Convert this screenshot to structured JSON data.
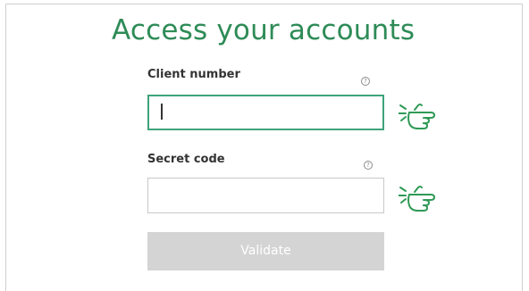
{
  "form": {
    "title": "Access your accounts",
    "client_number": {
      "label": "Client number",
      "value": "",
      "help_glyph": "?"
    },
    "secret_code": {
      "label": "Secret code",
      "value": "",
      "help_glyph": "?"
    },
    "submit_label": "Validate"
  },
  "icons": {
    "help": "question-circle-icon",
    "pointer": "pointing-hand-icon"
  },
  "colors": {
    "accent": "#2e8b57",
    "active_border": "#3ea37a",
    "button_disabled": "#d4d4d4"
  }
}
